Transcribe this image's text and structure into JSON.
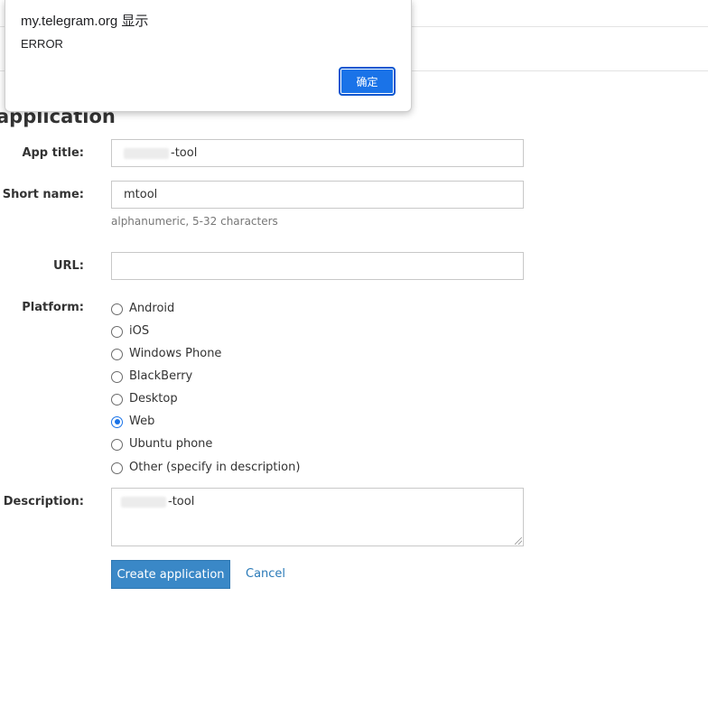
{
  "dialog": {
    "title": "my.telegram.org 显示",
    "message": "ERROR",
    "ok_label": "确定"
  },
  "page": {
    "title": "application"
  },
  "form": {
    "app_title": {
      "label": "App title:",
      "value_suffix": "-tool"
    },
    "short_name": {
      "label": "Short name:",
      "value": "mtool",
      "hint": "alphanumeric, 5-32 characters"
    },
    "url": {
      "label": "URL:",
      "value": ""
    },
    "platform": {
      "label": "Platform:",
      "options": [
        {
          "label": "Android",
          "checked": false
        },
        {
          "label": "iOS",
          "checked": false
        },
        {
          "label": "Windows Phone",
          "checked": false
        },
        {
          "label": "BlackBerry",
          "checked": false
        },
        {
          "label": "Desktop",
          "checked": false
        },
        {
          "label": "Web",
          "checked": true
        },
        {
          "label": "Ubuntu phone",
          "checked": false
        },
        {
          "label": "Other (specify in description)",
          "checked": false
        }
      ]
    },
    "description": {
      "label": "Description:",
      "value_suffix": "-tool"
    },
    "submit_label": "Create application",
    "cancel_label": "Cancel"
  },
  "colors": {
    "primary_button": "#3a88c7",
    "link": "#2a7ab8",
    "dialog_button": "#1a73e8"
  }
}
